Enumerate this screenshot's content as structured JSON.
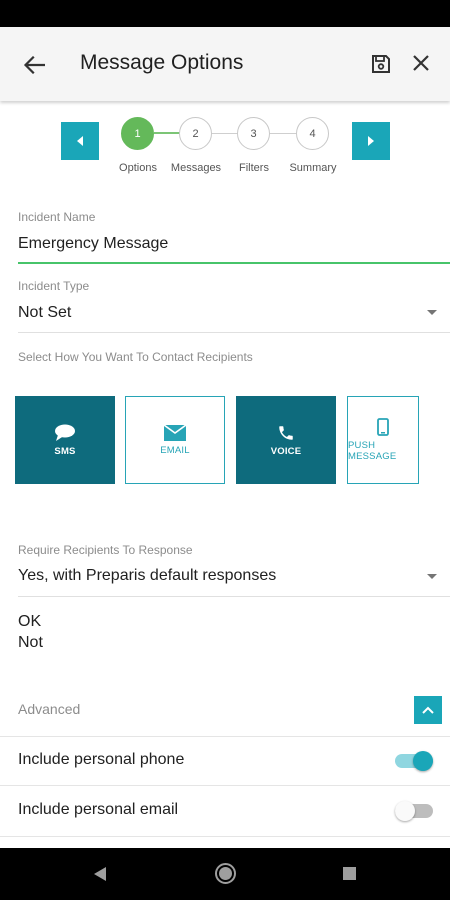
{
  "header": {
    "title": "Message Options",
    "back_icon": "arrow-left-icon",
    "save_icon": "floppy-disk-icon",
    "close_icon": "close-icon"
  },
  "stepper": {
    "prev_icon": "chevron-left-icon",
    "next_icon": "chevron-right-icon",
    "active_color": "#64b95a",
    "steps": [
      {
        "number": "1",
        "label": "Options"
      },
      {
        "number": "2",
        "label": "Messages"
      },
      {
        "number": "3",
        "label": "Filters"
      },
      {
        "number": "4",
        "label": "Summary"
      }
    ]
  },
  "form": {
    "incident_name": {
      "label": "Incident Name",
      "value": "Emergency Message"
    },
    "incident_type": {
      "label": "Incident Type",
      "value": "Not Set"
    },
    "contact_label": "Select How You Want To Contact Recipients",
    "channels": [
      {
        "label": "SMS",
        "icon": "chat-bubble-icon",
        "selected": true
      },
      {
        "label": "EMAIL",
        "icon": "envelope-icon",
        "selected": false
      },
      {
        "label": "VOICE",
        "icon": "phone-icon",
        "selected": true
      },
      {
        "label": "PUSH MESSAGE",
        "icon": "mobile-phone-icon",
        "selected": false
      }
    ],
    "require_response": {
      "label": "Require Recipients To Response",
      "value": "Yes, with Preparis default responses"
    },
    "responses": [
      "OK",
      "Not"
    ],
    "advanced": {
      "label": "Advanced",
      "icon": "chevron-up-icon"
    },
    "toggles": [
      {
        "label": "Include personal phone",
        "on": true
      },
      {
        "label": "Include personal email",
        "on": false
      }
    ]
  },
  "colors": {
    "accent": "#1aa6b8",
    "channel_selected": "#0e6b7d",
    "focus_underline": "#47c46a"
  },
  "system_nav": {
    "back_icon": "triangle-back-icon",
    "home_icon": "circle-home-icon",
    "recent_icon": "square-recents-icon"
  }
}
